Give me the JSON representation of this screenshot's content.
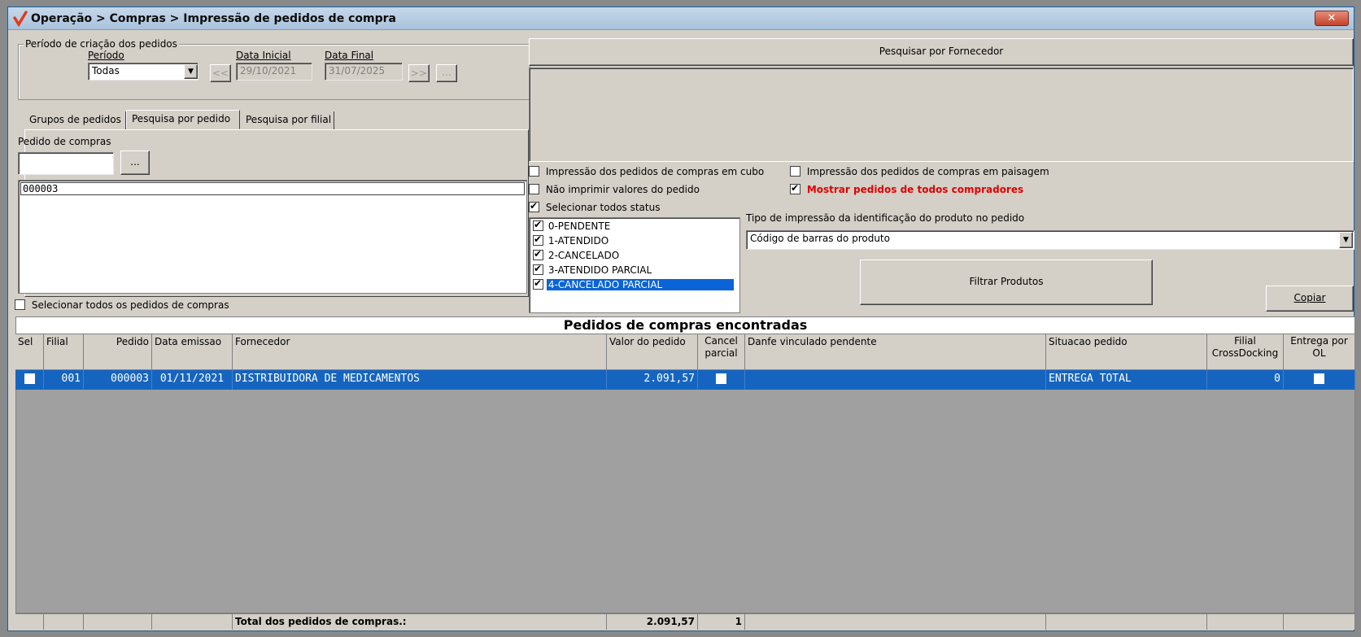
{
  "window": {
    "title": "Operação > Compras > Impressão de pedidos de compra",
    "close_label": "✕"
  },
  "periodo_group": {
    "legend": "Período de criação dos pedidos",
    "periodo_label": "Período",
    "periodo_value": "Todas",
    "data_inicial_label": "Data Inicial",
    "data_inicial_value": "29/10/2021",
    "data_final_label": "Data Final",
    "data_final_value": "31/07/2025",
    "prev_label": "<<",
    "next_label": ">>",
    "more_label": "..."
  },
  "tabs": [
    {
      "label": "Grupos de pedidos"
    },
    {
      "label": "Pesquisa por pedido"
    },
    {
      "label": "Pesquisa por filial"
    }
  ],
  "pedido_panel": {
    "label": "Pedido de compras",
    "input_value": "",
    "more_label": "...",
    "list_items": [
      "000003"
    ]
  },
  "select_all_orders": {
    "label": "Selecionar todos os pedidos de compras",
    "checked": false
  },
  "fornecedor": {
    "button_label": "Pesquisar por Fornecedor"
  },
  "options": {
    "cubo": {
      "label": "Impressão dos pedidos de compras em cubo",
      "checked": false
    },
    "paisagem": {
      "label": "Impressão dos pedidos de compras em paisagem",
      "checked": false
    },
    "nao_imprimir": {
      "label": "Não imprimir valores do pedido",
      "checked": false
    },
    "mostrar_todos": {
      "label": "Mostrar pedidos de todos compradores",
      "checked": true
    },
    "selecionar_status": {
      "label": "Selecionar todos status",
      "checked": true
    }
  },
  "status_list": [
    {
      "label": "0-PENDENTE",
      "checked": true
    },
    {
      "label": "1-ATENDIDO",
      "checked": true
    },
    {
      "label": "2-CANCELADO",
      "checked": true
    },
    {
      "label": "3-ATENDIDO PARCIAL",
      "checked": true
    },
    {
      "label": "4-CANCELADO PARCIAL",
      "checked": true
    }
  ],
  "tipo_impressao": {
    "label": "Tipo de impressão da identificação do produto no pedido",
    "value": "Código de barras do produto"
  },
  "buttons": {
    "filtrar": "Filtrar Produtos",
    "copiar": "Copiar"
  },
  "grid": {
    "title": "Pedidos de compras encontradas",
    "columns": [
      "Sel",
      "Filial",
      "Pedido",
      "Data emissao",
      "Fornecedor",
      "Valor do pedido",
      "Cancel parcial",
      "Danfe vinculado pendente",
      "Situacao pedido",
      "Filial CrossDocking",
      "Entrega por OL"
    ],
    "rows": [
      {
        "filial": "001",
        "pedido": "000003",
        "data_emissao": "01/11/2021",
        "fornecedor": "DISTRIBUIDORA DE MEDICAMENTOS",
        "valor": "2.091,57",
        "danfe": "",
        "situacao": "ENTREGA TOTAL",
        "crossdocking": "0"
      }
    ],
    "footer": {
      "label": "Total dos pedidos de compras.:",
      "total": "2.091,57",
      "count": "1"
    }
  },
  "colors": {
    "selection": "#1565c0",
    "accent_red": "#e00000"
  }
}
